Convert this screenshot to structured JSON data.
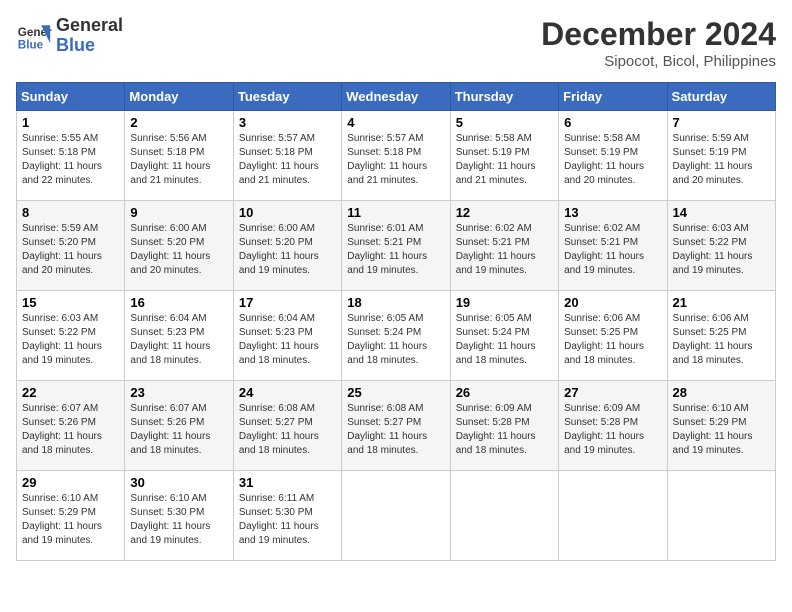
{
  "header": {
    "logo_line1": "General",
    "logo_line2": "Blue",
    "month": "December 2024",
    "location": "Sipocot, Bicol, Philippines"
  },
  "weekdays": [
    "Sunday",
    "Monday",
    "Tuesday",
    "Wednesday",
    "Thursday",
    "Friday",
    "Saturday"
  ],
  "weeks": [
    [
      {
        "day": "1",
        "sunrise": "5:55 AM",
        "sunset": "5:18 PM",
        "daylight": "11 hours and 22 minutes."
      },
      {
        "day": "2",
        "sunrise": "5:56 AM",
        "sunset": "5:18 PM",
        "daylight": "11 hours and 21 minutes."
      },
      {
        "day": "3",
        "sunrise": "5:57 AM",
        "sunset": "5:18 PM",
        "daylight": "11 hours and 21 minutes."
      },
      {
        "day": "4",
        "sunrise": "5:57 AM",
        "sunset": "5:18 PM",
        "daylight": "11 hours and 21 minutes."
      },
      {
        "day": "5",
        "sunrise": "5:58 AM",
        "sunset": "5:19 PM",
        "daylight": "11 hours and 21 minutes."
      },
      {
        "day": "6",
        "sunrise": "5:58 AM",
        "sunset": "5:19 PM",
        "daylight": "11 hours and 20 minutes."
      },
      {
        "day": "7",
        "sunrise": "5:59 AM",
        "sunset": "5:19 PM",
        "daylight": "11 hours and 20 minutes."
      }
    ],
    [
      {
        "day": "8",
        "sunrise": "5:59 AM",
        "sunset": "5:20 PM",
        "daylight": "11 hours and 20 minutes."
      },
      {
        "day": "9",
        "sunrise": "6:00 AM",
        "sunset": "5:20 PM",
        "daylight": "11 hours and 20 minutes."
      },
      {
        "day": "10",
        "sunrise": "6:00 AM",
        "sunset": "5:20 PM",
        "daylight": "11 hours and 19 minutes."
      },
      {
        "day": "11",
        "sunrise": "6:01 AM",
        "sunset": "5:21 PM",
        "daylight": "11 hours and 19 minutes."
      },
      {
        "day": "12",
        "sunrise": "6:02 AM",
        "sunset": "5:21 PM",
        "daylight": "11 hours and 19 minutes."
      },
      {
        "day": "13",
        "sunrise": "6:02 AM",
        "sunset": "5:21 PM",
        "daylight": "11 hours and 19 minutes."
      },
      {
        "day": "14",
        "sunrise": "6:03 AM",
        "sunset": "5:22 PM",
        "daylight": "11 hours and 19 minutes."
      }
    ],
    [
      {
        "day": "15",
        "sunrise": "6:03 AM",
        "sunset": "5:22 PM",
        "daylight": "11 hours and 19 minutes."
      },
      {
        "day": "16",
        "sunrise": "6:04 AM",
        "sunset": "5:23 PM",
        "daylight": "11 hours and 18 minutes."
      },
      {
        "day": "17",
        "sunrise": "6:04 AM",
        "sunset": "5:23 PM",
        "daylight": "11 hours and 18 minutes."
      },
      {
        "day": "18",
        "sunrise": "6:05 AM",
        "sunset": "5:24 PM",
        "daylight": "11 hours and 18 minutes."
      },
      {
        "day": "19",
        "sunrise": "6:05 AM",
        "sunset": "5:24 PM",
        "daylight": "11 hours and 18 minutes."
      },
      {
        "day": "20",
        "sunrise": "6:06 AM",
        "sunset": "5:25 PM",
        "daylight": "11 hours and 18 minutes."
      },
      {
        "day": "21",
        "sunrise": "6:06 AM",
        "sunset": "5:25 PM",
        "daylight": "11 hours and 18 minutes."
      }
    ],
    [
      {
        "day": "22",
        "sunrise": "6:07 AM",
        "sunset": "5:26 PM",
        "daylight": "11 hours and 18 minutes."
      },
      {
        "day": "23",
        "sunrise": "6:07 AM",
        "sunset": "5:26 PM",
        "daylight": "11 hours and 18 minutes."
      },
      {
        "day": "24",
        "sunrise": "6:08 AM",
        "sunset": "5:27 PM",
        "daylight": "11 hours and 18 minutes."
      },
      {
        "day": "25",
        "sunrise": "6:08 AM",
        "sunset": "5:27 PM",
        "daylight": "11 hours and 18 minutes."
      },
      {
        "day": "26",
        "sunrise": "6:09 AM",
        "sunset": "5:28 PM",
        "daylight": "11 hours and 18 minutes."
      },
      {
        "day": "27",
        "sunrise": "6:09 AM",
        "sunset": "5:28 PM",
        "daylight": "11 hours and 19 minutes."
      },
      {
        "day": "28",
        "sunrise": "6:10 AM",
        "sunset": "5:29 PM",
        "daylight": "11 hours and 19 minutes."
      }
    ],
    [
      {
        "day": "29",
        "sunrise": "6:10 AM",
        "sunset": "5:29 PM",
        "daylight": "11 hours and 19 minutes."
      },
      {
        "day": "30",
        "sunrise": "6:10 AM",
        "sunset": "5:30 PM",
        "daylight": "11 hours and 19 minutes."
      },
      {
        "day": "31",
        "sunrise": "6:11 AM",
        "sunset": "5:30 PM",
        "daylight": "11 hours and 19 minutes."
      },
      null,
      null,
      null,
      null
    ]
  ]
}
